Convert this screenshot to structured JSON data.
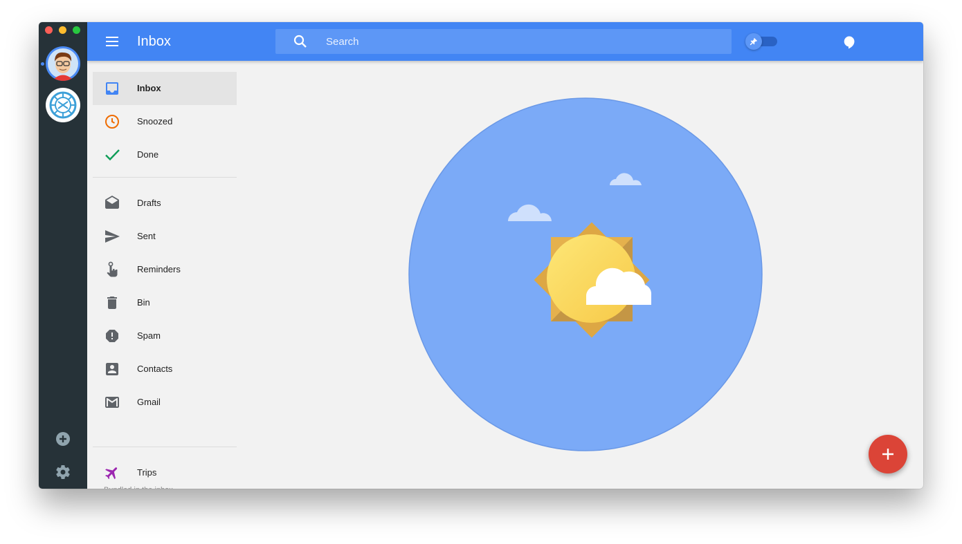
{
  "topbar": {
    "title": "Inbox",
    "search_placeholder": "Search"
  },
  "nav": {
    "items": [
      {
        "label": "Inbox",
        "icon": "inbox-icon",
        "active": true
      },
      {
        "label": "Snoozed",
        "icon": "clock-icon"
      },
      {
        "label": "Done",
        "icon": "check-icon"
      },
      {
        "label": "Drafts",
        "icon": "drafts-icon"
      },
      {
        "label": "Sent",
        "icon": "send-icon"
      },
      {
        "label": "Reminders",
        "icon": "reminder-hand-icon"
      },
      {
        "label": "Bin",
        "icon": "trash-icon"
      },
      {
        "label": "Spam",
        "icon": "spam-icon"
      },
      {
        "label": "Contacts",
        "icon": "contacts-icon"
      },
      {
        "label": "Gmail",
        "icon": "gmail-icon"
      },
      {
        "label": "Trips",
        "icon": "airplane-icon"
      }
    ],
    "footer": "Bundled in the inbox"
  },
  "colors": {
    "topbar": "#4285f4",
    "rail": "#263238",
    "fab": "#db4437",
    "illustration_circle": "#7baaf7"
  }
}
